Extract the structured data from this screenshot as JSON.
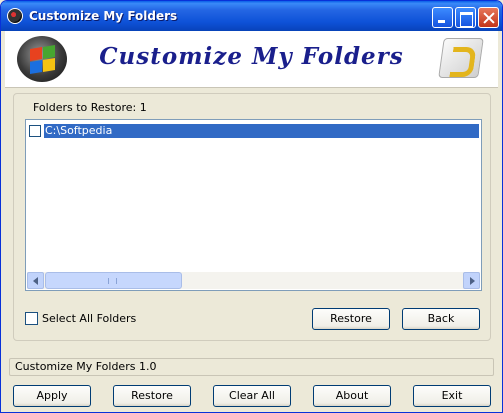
{
  "window": {
    "title": "Customize My Folders",
    "icon": "app-disc-icon",
    "controls": [
      "minimize-icon",
      "maximize-icon",
      "close-icon"
    ]
  },
  "banner": {
    "title": "Customize My Folders",
    "left_logo": "windows-logo-icon",
    "right_logo": "question-mark-icon"
  },
  "restore": {
    "count_label": "Folders to Restore: 1",
    "items": [
      {
        "label": "C:\\Softpedia",
        "checked": false,
        "selected": true
      }
    ],
    "select_all_label": "Select All Folders",
    "restore_button": "Restore",
    "back_button": "Back"
  },
  "status": {
    "text": "Customize My Folders 1.0"
  },
  "footer": {
    "apply": "Apply",
    "restore": "Restore",
    "clear_all": "Clear All",
    "about": "About",
    "exit": "Exit"
  },
  "colors": {
    "titlebar": "#0a47c4",
    "selection": "#316ac5",
    "banner_title": "#1a1f8c",
    "window_bg": "#ece9d8"
  }
}
